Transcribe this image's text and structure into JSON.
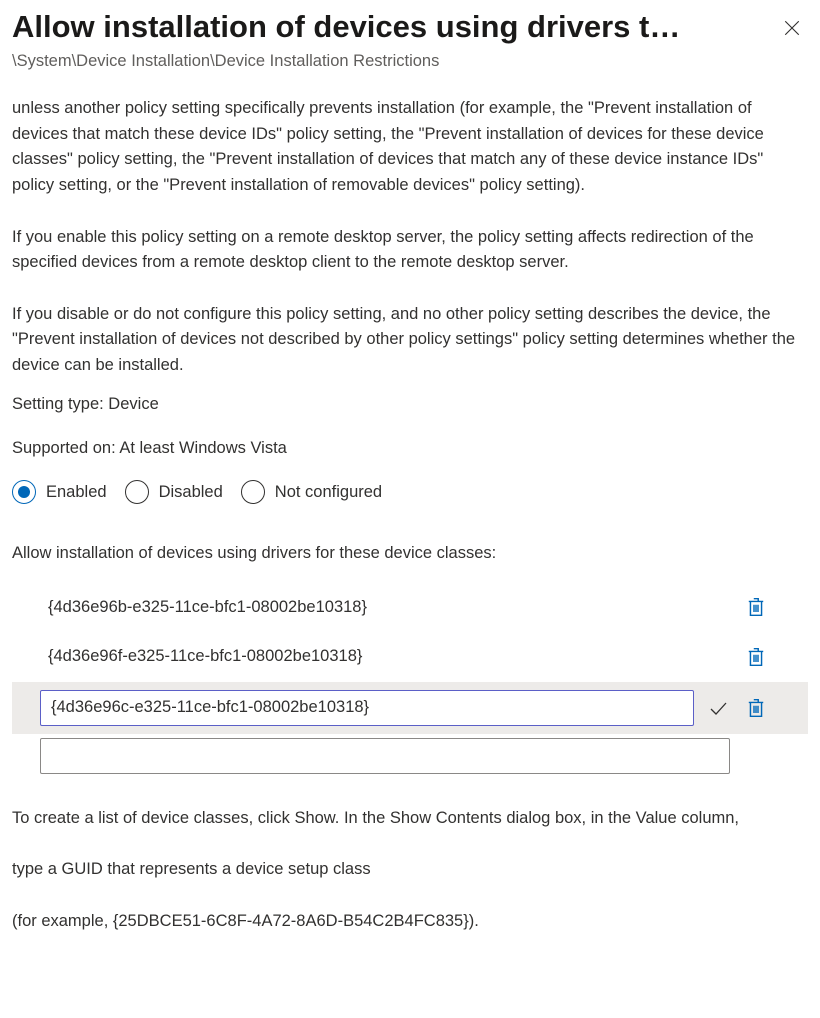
{
  "header": {
    "title": "Allow installation of devices using drivers t…",
    "breadcrumb": "\\System\\Device Installation\\Device Installation Restrictions"
  },
  "description": {
    "p1": "unless another policy setting specifically prevents installation (for example, the \"Prevent installation of devices that match these device IDs\" policy setting, the \"Prevent installation of devices for these device classes\" policy setting, the \"Prevent installation of devices that match any of these device instance IDs\" policy setting, or the \"Prevent installation of removable devices\" policy setting).",
    "p2": "If you enable this policy setting on a remote desktop server, the policy setting affects redirection of the specified devices from a remote desktop client to the remote desktop server.",
    "p3": "If you disable or do not configure this policy setting, and no other policy setting describes the device, the \"Prevent installation of devices not described by other policy settings\" policy setting determines whether the device can be installed."
  },
  "meta": {
    "setting_type": "Setting type: Device",
    "supported_on": "Supported on: At least Windows Vista"
  },
  "state_options": {
    "enabled": "Enabled",
    "disabled": "Disabled",
    "not_configured": "Not configured",
    "selected": "enabled"
  },
  "device_classes": {
    "label": "Allow installation of devices using drivers for these device classes:",
    "items": [
      "{4d36e96b-e325-11ce-bfc1-08002be10318}",
      "{4d36e96f-e325-11ce-bfc1-08002be10318}"
    ],
    "editing_value": "{4d36e96c-e325-11ce-bfc1-08002be10318}",
    "new_value": ""
  },
  "footer": {
    "p1": "To create a list of device classes, click Show. In the Show Contents dialog box, in the Value column,",
    "p2": "type a GUID that represents a device setup class",
    "p3": "(for example, {25DBCE51-6C8F-4A72-8A6D-B54C2B4FC835})."
  }
}
